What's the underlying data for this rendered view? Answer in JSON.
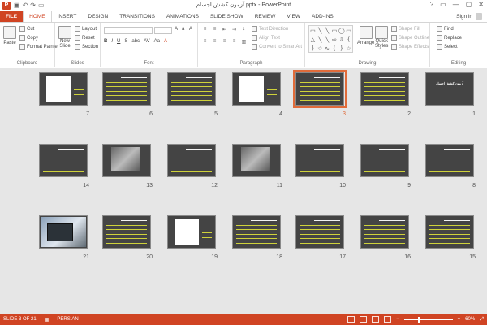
{
  "window": {
    "title": "آزمون کشش اجسام.pptx - PowerPoint",
    "app_icon_letter": "P",
    "quick_access": [
      "save-icon",
      "undo-icon",
      "redo-icon",
      "slideshow-icon"
    ],
    "controls": [
      "?",
      "▭",
      "—",
      "▢",
      "✕"
    ]
  },
  "tabs": [
    "FILE",
    "HOME",
    "INSERT",
    "DESIGN",
    "TRANSITIONS",
    "ANIMATIONS",
    "SLIDE SHOW",
    "REVIEW",
    "VIEW",
    "ADD-INS"
  ],
  "active_tab": "HOME",
  "sign_in": "Sign in",
  "ribbon": {
    "clipboard": {
      "paste": "Paste",
      "cut": "Cut",
      "copy": "Copy",
      "format_painter": "Format Painter",
      "label": "Clipboard"
    },
    "slides": {
      "new_slide": "New",
      "new_slide2": "Slide",
      "layout": "Layout",
      "reset": "Reset",
      "section": "Section",
      "label": "Slides"
    },
    "font": {
      "font_name": "",
      "font_size": "",
      "label": "Font",
      "styles": [
        "B",
        "I",
        "U",
        "S",
        "abc",
        "AV",
        "Aa",
        "A"
      ]
    },
    "paragraph": {
      "text_direction": "Text Direction",
      "align_text": "Align Text",
      "convert": "Convert to SmartArt",
      "label": "Paragraph"
    },
    "drawing": {
      "arrange": "Arrange",
      "quick_styles": "Quick",
      "quick_styles2": "Styles",
      "fill": "Shape Fill",
      "outline": "Shape Outline",
      "effects": "Shape Effects",
      "label": "Drawing"
    },
    "editing": {
      "find": "Find",
      "replace": "Replace",
      "select": "Select",
      "label": "Editing"
    }
  },
  "slides": [
    {
      "n": "1",
      "kind": "title",
      "title": "آزمون کشش اجسام"
    },
    {
      "n": "2",
      "kind": "text"
    },
    {
      "n": "3",
      "kind": "text",
      "selected": true
    },
    {
      "n": "4",
      "kind": "chart"
    },
    {
      "n": "5",
      "kind": "text"
    },
    {
      "n": "6",
      "kind": "text"
    },
    {
      "n": "7",
      "kind": "chart"
    },
    {
      "n": "8",
      "kind": "text"
    },
    {
      "n": "9",
      "kind": "text"
    },
    {
      "n": "10",
      "kind": "text"
    },
    {
      "n": "11",
      "kind": "photo"
    },
    {
      "n": "12",
      "kind": "text"
    },
    {
      "n": "13",
      "kind": "photo"
    },
    {
      "n": "14",
      "kind": "text"
    },
    {
      "n": "15",
      "kind": "text"
    },
    {
      "n": "16",
      "kind": "text"
    },
    {
      "n": "17",
      "kind": "text"
    },
    {
      "n": "18",
      "kind": "text"
    },
    {
      "n": "19",
      "kind": "chart"
    },
    {
      "n": "20",
      "kind": "text"
    },
    {
      "n": "21",
      "kind": "laptop"
    }
  ],
  "status": {
    "slide_info": "SLIDE 3 OF 21",
    "language": "PERSIAN",
    "zoom": "60%",
    "zoom_fraction": 0.3
  },
  "colors": {
    "accent": "#d04423",
    "selection": "#e06b3a",
    "thumb_bg": "#444444",
    "thumb_text": "#cfd23a"
  }
}
